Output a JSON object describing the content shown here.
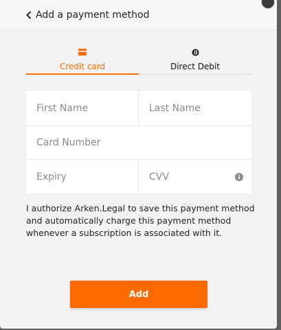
{
  "header": {
    "back_label": "Add a payment method"
  },
  "tabs": [
    {
      "label": "Credit card",
      "icon": "credit-card-icon",
      "active": true
    },
    {
      "label": "Direct Debit",
      "icon": "bank-icon",
      "active": false
    }
  ],
  "form": {
    "first_name_placeholder": "First Name",
    "last_name_placeholder": "Last Name",
    "card_number_placeholder": "Card Number",
    "expiry_placeholder": "Expiry",
    "cvv_placeholder": "CVV"
  },
  "consent_text": "I authorize Arken.Legal to save this payment method and automatically charge this payment method whenever a subscription is associated with it.",
  "add_button_label": "Add",
  "colors": {
    "accent": "#ff6a00",
    "background": "#f3f3f3",
    "field_bg": "#ffffff"
  }
}
